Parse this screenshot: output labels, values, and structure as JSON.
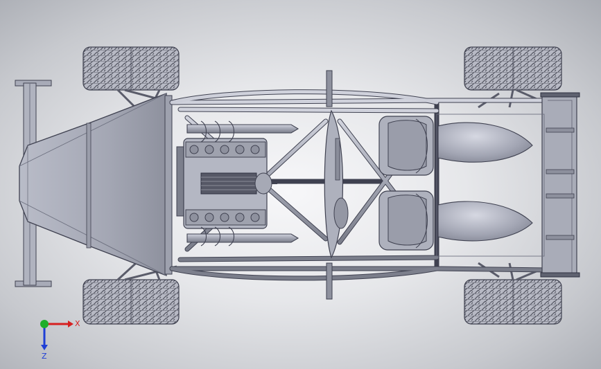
{
  "viewport": {
    "background_center": "#f7f7f9",
    "background_edge": "#a9acb3"
  },
  "model": {
    "body_color": "#a9acbb",
    "body_light": "#c4c7d3",
    "body_dark": "#7e8190",
    "edge_color": "#3f4150",
    "tire_color": "#b5b7c2",
    "tread_color": "#4a4c58"
  },
  "triad": {
    "x_label": "X",
    "z_label": "Z",
    "x_color": "#d62020",
    "y_color": "#1fae2a",
    "z_color": "#1f3fd6"
  }
}
